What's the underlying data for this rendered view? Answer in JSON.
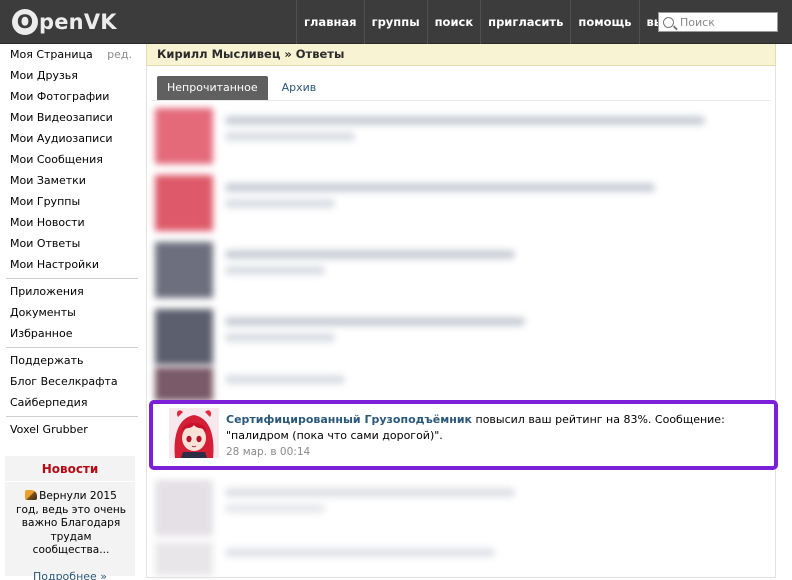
{
  "header": {
    "logo_letter": "O",
    "logo_text": "penVK",
    "nav": [
      "главная",
      "группы",
      "поиск",
      "пригласить",
      "помощь",
      "выйти"
    ],
    "search_placeholder": "Поиск"
  },
  "sidebar": {
    "group1": [
      "Моя Страница",
      "Мои Друзья",
      "Мои Фотографии",
      "Мои Видеозаписи",
      "Мои Аудиозаписи",
      "Мои Сообщения",
      "Мои Заметки",
      "Мои Группы",
      "Мои Новости",
      "Мои Ответы",
      "Мои Настройки"
    ],
    "edit_label": "ред.",
    "group2": [
      "Приложения",
      "Документы",
      "Избранное"
    ],
    "group3": [
      "Поддержать",
      "Блог Веселкрафта",
      "Сайберпедия"
    ],
    "group4": [
      "Voxel Grubber"
    ],
    "news": {
      "title": "Новости",
      "text": "Вернули 2015 год, ведь это очень важно Благодаря трудам сообщества...",
      "more": "Подробнее »"
    }
  },
  "main": {
    "breadcrumb_user": "Кирилл Мысливец",
    "breadcrumb_sep": " » ",
    "breadcrumb_page": "Ответы",
    "tabs": [
      "Непрочитанное",
      "Архив"
    ],
    "highlighted": {
      "user": "Сертифицированный Грузоподъёмник",
      "message": " повысил ваш рейтинг на 83%. Сообщение: \"палидром (пока что сами дорогой)\".",
      "time": "28 мар. в 00:14"
    }
  },
  "colors": {
    "header_bg": "#3c3c3c",
    "link": "#2b587a",
    "news_title": "#b40b15",
    "highlight_border": "#7b1fd8",
    "breadcrumb_bg": "#f7f3d3"
  }
}
